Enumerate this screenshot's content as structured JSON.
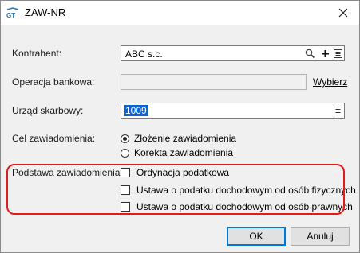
{
  "window": {
    "title": "ZAW-NR"
  },
  "form": {
    "kontrahent": {
      "label": "Kontrahent:",
      "value": "ABC s.c."
    },
    "operacja": {
      "label": "Operacja bankowa:",
      "value": "",
      "link": "Wybierz"
    },
    "urzad": {
      "label": "Urząd skarbowy:",
      "value": "1009"
    },
    "cel": {
      "label": "Cel zawiadomienia:",
      "options": [
        {
          "label": "Złożenie zawiadomienia",
          "checked": true
        },
        {
          "label": "Korekta zawiadomienia",
          "checked": false
        }
      ]
    },
    "podstawa": {
      "label": "Podstawa zawiadomienia:",
      "options": [
        {
          "label": "Ordynacja podatkowa",
          "checked": false
        },
        {
          "label": "Ustawa o podatku dochodowym od osób fizycznych",
          "checked": false
        },
        {
          "label": "Ustawa o podatku dochodowym od osób prawnych",
          "checked": false
        }
      ]
    }
  },
  "buttons": {
    "ok": "OK",
    "cancel": "Anuluj"
  },
  "colors": {
    "highlight": "#e21b1b",
    "selection": "#0a64d6",
    "dialog_bg": "#f0f0f0"
  },
  "icons": [
    "app-logo-icon",
    "close-icon",
    "search-icon",
    "plus-icon",
    "list-icon"
  ]
}
